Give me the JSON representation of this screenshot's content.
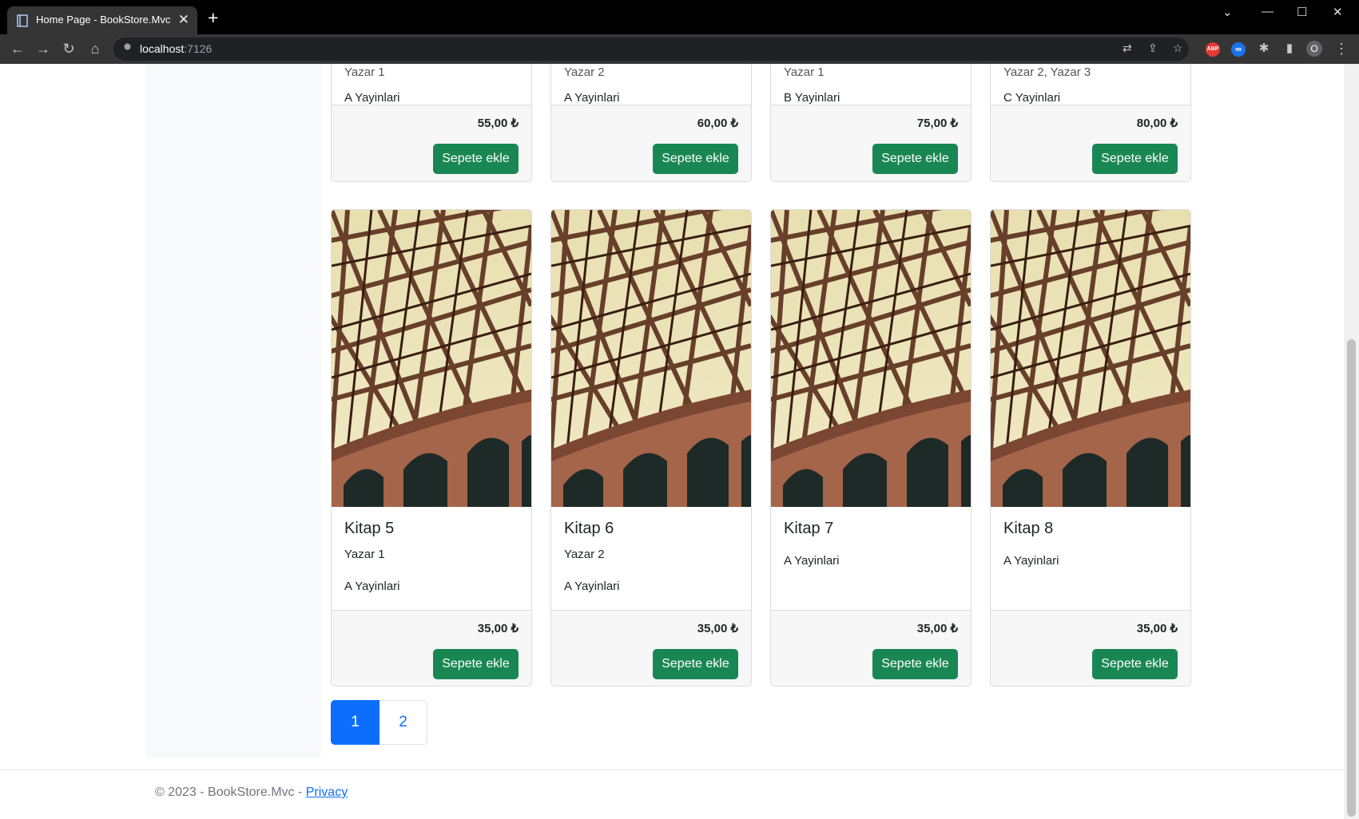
{
  "browser": {
    "tab_title": "Home Page - BookStore.Mvc",
    "url_host": "localhost",
    "url_port": ":7126",
    "profile_initial": "O",
    "extensions": [
      "ABP",
      "∞"
    ]
  },
  "top_row": [
    {
      "author": "Yazar 1",
      "publisher": "A Yayinlari",
      "price": "55,00 ₺",
      "button": "Sepete ekle"
    },
    {
      "author": "Yazar 2",
      "publisher": "A Yayinlari",
      "price": "60,00 ₺",
      "button": "Sepete ekle"
    },
    {
      "author": "Yazar 1",
      "publisher": "B Yayinlari",
      "price": "75,00 ₺",
      "button": "Sepete ekle"
    },
    {
      "author": "Yazar 2, Yazar 3",
      "publisher": "C Yayinlari",
      "price": "80,00 ₺",
      "button": "Sepete ekle"
    }
  ],
  "books": [
    {
      "name": "Kitap 5",
      "author": "Yazar 1",
      "publisher": "A Yayinlari",
      "price": "35,00 ₺",
      "button": "Sepete ekle"
    },
    {
      "name": "Kitap 6",
      "author": "Yazar 2",
      "publisher": "A Yayinlari",
      "price": "35,00 ₺",
      "button": "Sepete ekle"
    },
    {
      "name": "Kitap 7",
      "author": "",
      "publisher": "A Yayinlari",
      "price": "35,00 ₺",
      "button": "Sepete ekle"
    },
    {
      "name": "Kitap 8",
      "author": "",
      "publisher": "A Yayinlari",
      "price": "35,00 ₺",
      "button": "Sepete ekle"
    }
  ],
  "pagination": {
    "current": "1",
    "pages": [
      "1",
      "2"
    ]
  },
  "footer": {
    "copyright": "© 2023 - BookStore.Mvc - ",
    "privacy_link": "Privacy"
  },
  "colors": {
    "accent_green": "#198754",
    "active_page": "#0d6efd"
  }
}
